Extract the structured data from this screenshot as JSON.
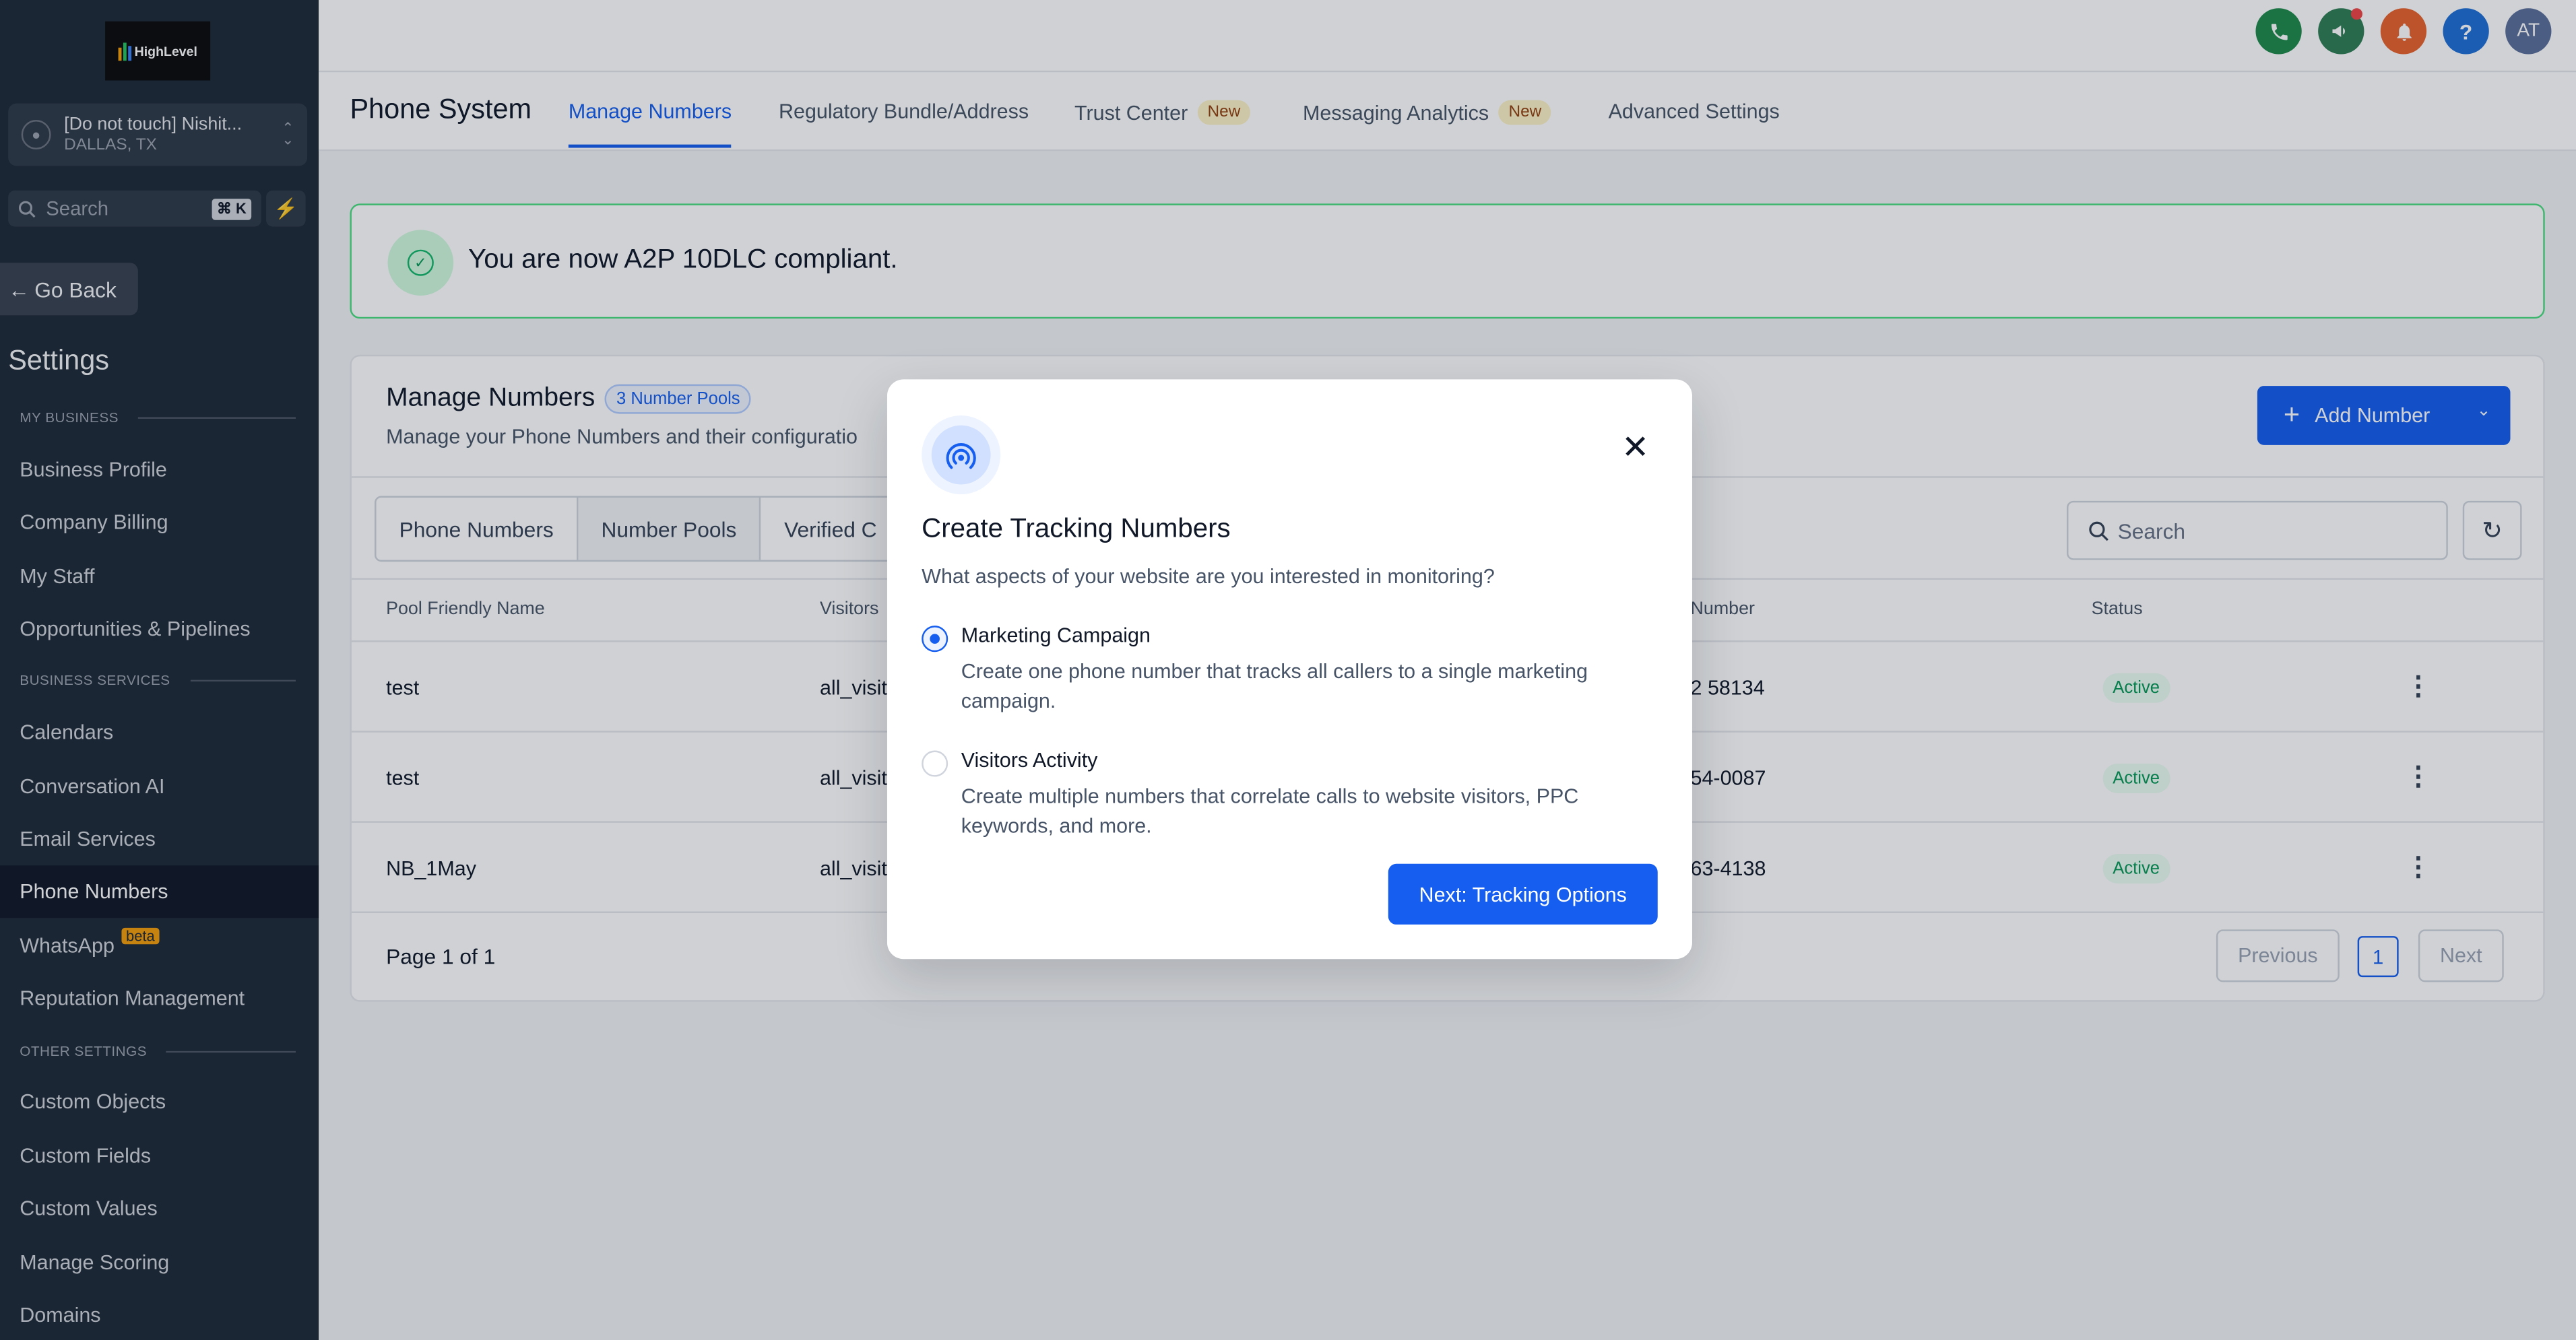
{
  "sidebar": {
    "logo_text": "HighLevel",
    "location": {
      "name": "[Do not touch] Nishit...",
      "city": "DALLAS, TX"
    },
    "search": {
      "placeholder": "Search",
      "shortcut": "⌘ K"
    },
    "go_back": "Go Back",
    "heading": "Settings",
    "sections": [
      {
        "label": "MY BUSINESS",
        "items": [
          "Business Profile",
          "Company Billing",
          "My Staff",
          "Opportunities & Pipelines"
        ]
      },
      {
        "label": "BUSINESS SERVICES",
        "items": [
          "Calendars",
          "Conversation AI",
          "Email Services",
          "Phone Numbers",
          "WhatsApp",
          "Reputation Management"
        ]
      },
      {
        "label": "OTHER SETTINGS",
        "items": [
          "Custom Objects",
          "Custom Fields",
          "Custom Values",
          "Manage Scoring",
          "Domains"
        ]
      }
    ],
    "active_item": "Phone Numbers",
    "beta_badge": "beta"
  },
  "topbar": {
    "avatar": "AT",
    "help_glyph": "?",
    "colors": {
      "phone": "#1f8a4c",
      "megaphone": "#2e7d53",
      "bell": "#e8622c",
      "help": "#1d6fd6",
      "avatar": "#5b6e9a"
    }
  },
  "page": {
    "title": "Phone System",
    "tabs": [
      {
        "label": "Manage Numbers",
        "active": true
      },
      {
        "label": "Regulatory Bundle/Address",
        "active": false
      },
      {
        "label": "Trust Center",
        "badge": "New"
      },
      {
        "label": "Messaging Analytics",
        "badge": "New"
      },
      {
        "label": "Advanced Settings"
      }
    ]
  },
  "banner": {
    "message": "You are now A2P 10DLC compliant."
  },
  "manage": {
    "title": "Manage Numbers",
    "pools_badge": "3 Number Pools",
    "subtitle": "Manage your Phone Numbers and their configuratio",
    "add_button": "Add Number",
    "segments": [
      "Phone Numbers",
      "Number Pools",
      "Verified C"
    ],
    "search_placeholder": "Search",
    "columns": [
      "Pool Friendly Name",
      "Visitors",
      "Number",
      "Status"
    ],
    "rows": [
      {
        "name": "test",
        "visitors": "all_visit",
        "number": "2 58134",
        "status": "Active"
      },
      {
        "name": "test",
        "visitors": "all_visit",
        "number": "54-0087",
        "status": "Active"
      },
      {
        "name": "NB_1May",
        "visitors": "all_visit",
        "number": "63-4138",
        "status": "Active"
      }
    ],
    "pagination": {
      "label": "Page 1 of 1",
      "previous": "Previous",
      "current": "1",
      "next": "Next"
    }
  },
  "modal": {
    "title": "Create Tracking Numbers",
    "question": "What aspects of your website are you interested in monitoring?",
    "options": [
      {
        "title": "Marketing Campaign",
        "description": "Create one phone number that tracks all callers to a single marketing campaign.",
        "selected": true
      },
      {
        "title": "Visitors Activity",
        "description": "Create multiple numbers that correlate calls to website visitors, PPC keywords, and more.",
        "selected": false
      }
    ],
    "next_button": "Next: Tracking Options"
  }
}
